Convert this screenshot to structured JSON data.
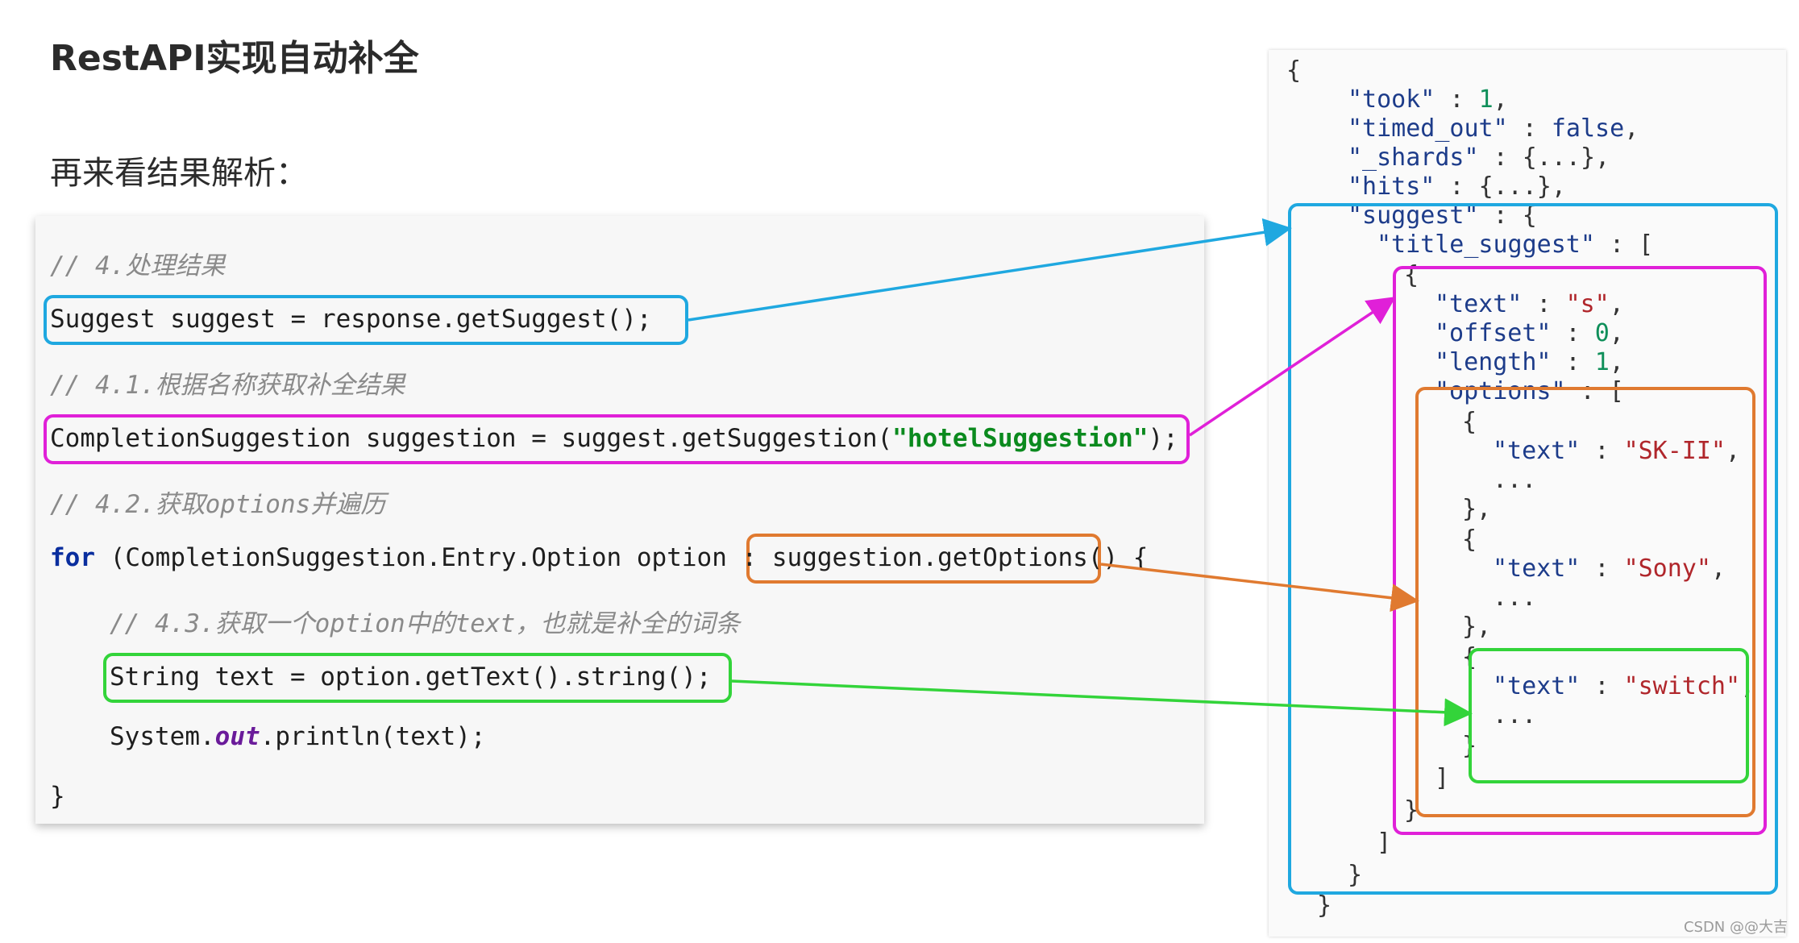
{
  "header": {
    "title": "RestAPI实现自动补全",
    "subtitle": "再来看结果解析："
  },
  "code": {
    "comment_1": "// 4.处理结果",
    "line_suggest": "Suggest suggest = response.getSuggest();",
    "comment_2": "// 4.1.根据名称获取补全结果",
    "line_completion_prefix": "CompletionSuggestion suggestion = suggest.getSuggestion(",
    "line_completion_string": "\"hotelSuggestion\"",
    "line_completion_suffix": ");",
    "comment_3": "// 4.2.获取options并遍历",
    "for_keyword": "for",
    "for_decl": " (CompletionSuggestion.Entry.Option option : ",
    "for_iter": "suggestion.getOptions()",
    "for_open": " {",
    "comment_4": "// 4.3.获取一个option中的text，也就是补全的词条",
    "line_text": "String text = option.getText().string();",
    "println_prefix": "System.",
    "println_field": "out",
    "println_suffix": ".println(text);",
    "closing_brace": "}"
  },
  "json": {
    "open": "{",
    "took_key": "\"took\"",
    "took_value": "1",
    "timed_out_key": "\"timed_out\"",
    "timed_out_value": "false",
    "shards_key": "\"_shards\"",
    "shards_value": "{...}",
    "hits_key": "\"hits\"",
    "hits_value": "{...}",
    "suggest_key": "\"suggest\"",
    "title_suggest_key": "\"title_suggest\"",
    "entry_open": "{",
    "text_key": "\"text\"",
    "text_value": "\"s\"",
    "offset_key": "\"offset\"",
    "offset_value": "0",
    "length_key": "\"length\"",
    "length_value": "1",
    "options_key": "\"options\"",
    "opt1_text": "\"SK-II\"",
    "opt2_text": "\"Sony\"",
    "opt3_text": "\"switch\"",
    "ellipsis": "...",
    "obj_open": "{",
    "obj_close": "},",
    "obj_close_last": "}",
    "arr_close": "]",
    "entry_close": "}",
    "title_arr_close": "]",
    "suggest_close": "}",
    "close": "}"
  },
  "colors": {
    "blue": "#1fa8e0",
    "magenta": "#e020d8",
    "orange": "#e07a30",
    "green": "#33d43a"
  },
  "watermark": "CSDN @@大吉"
}
